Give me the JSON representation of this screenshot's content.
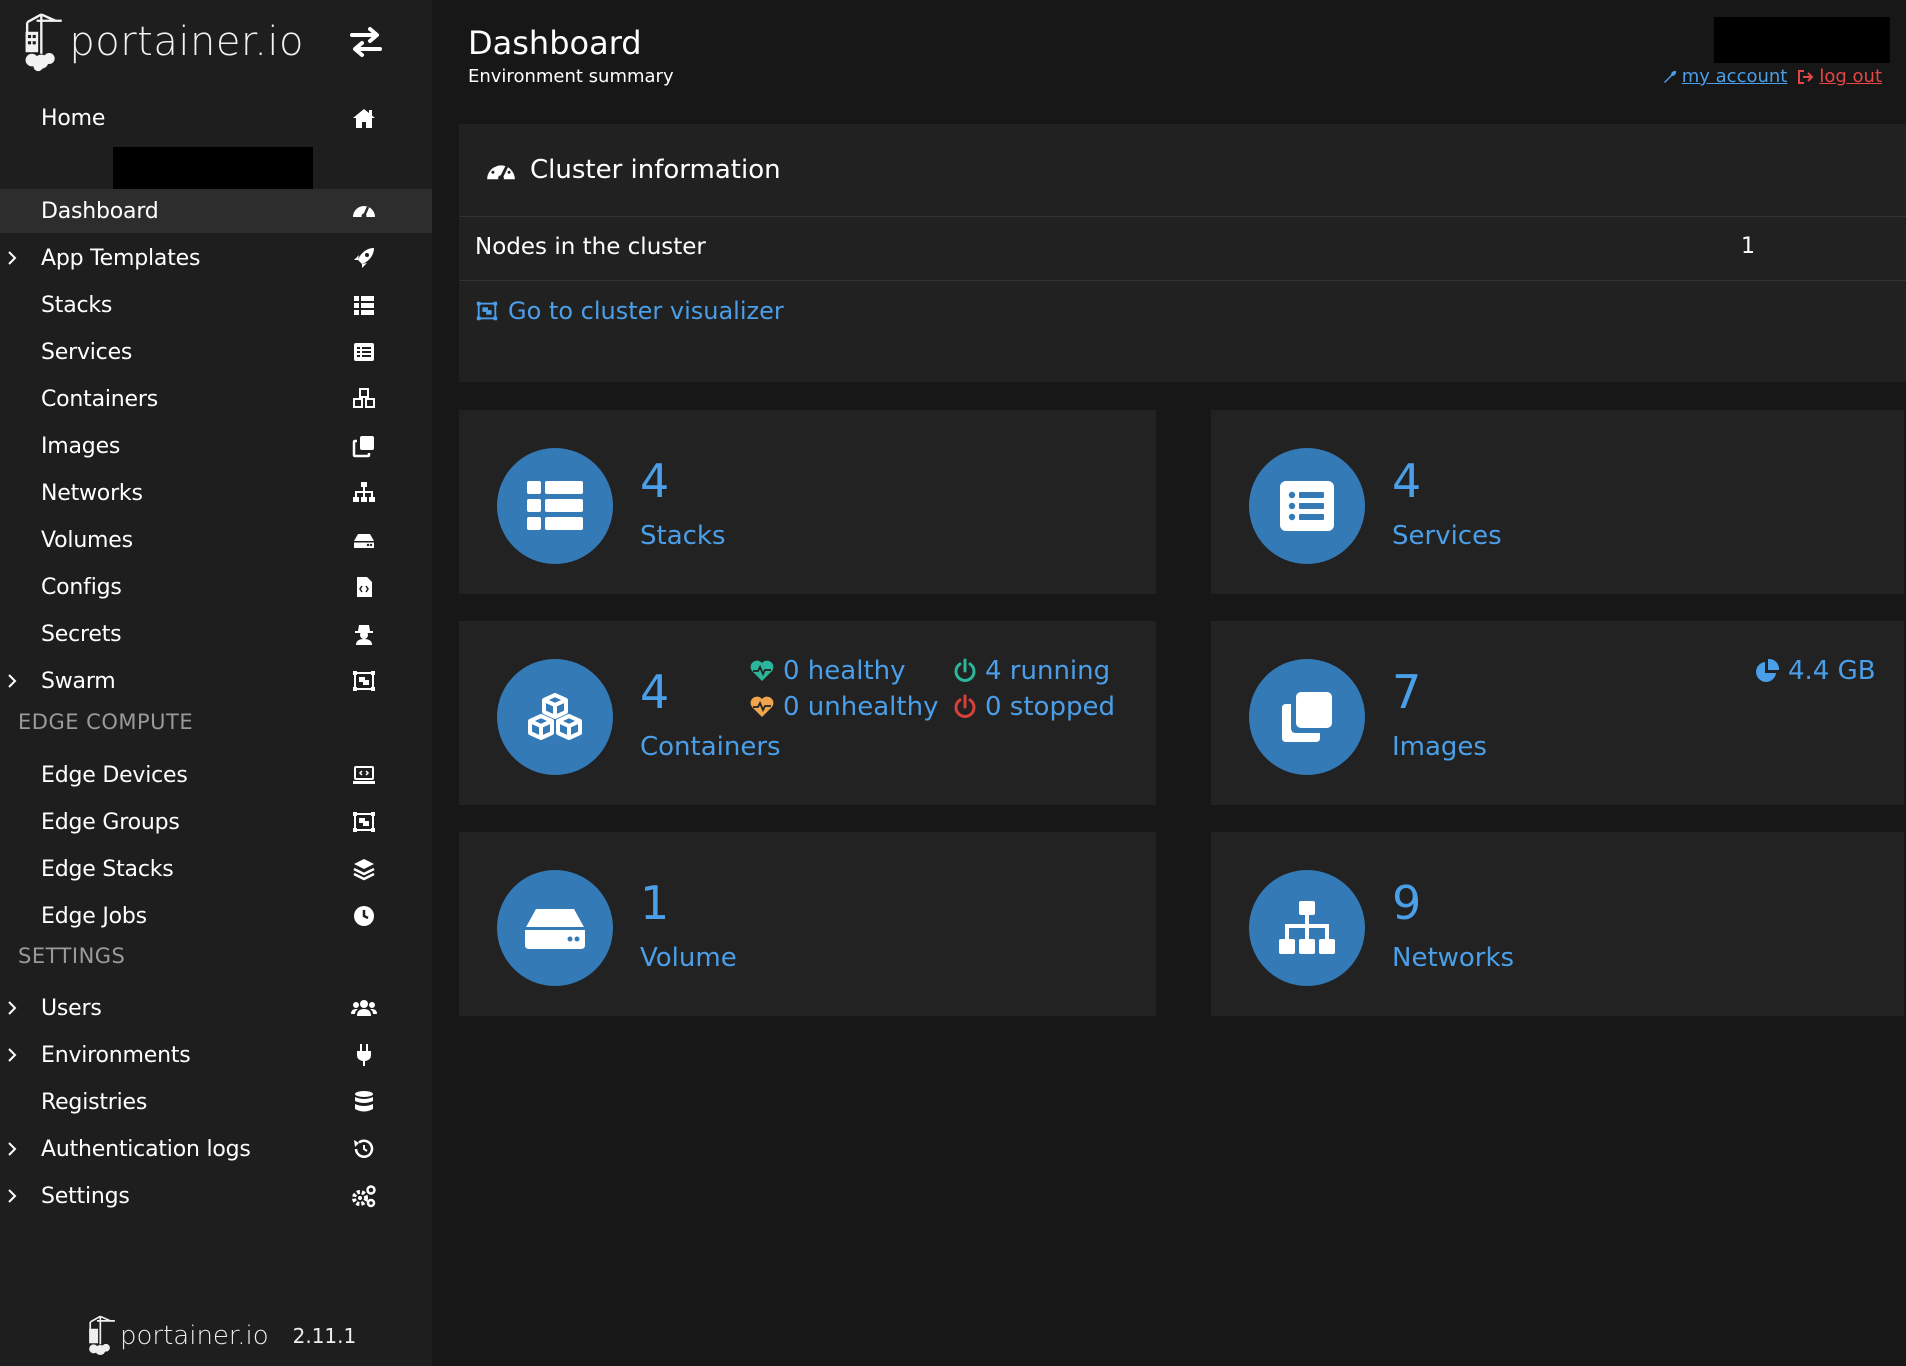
{
  "brand": {
    "name": "portainer.io",
    "version": "2.11.1"
  },
  "sidebar": {
    "home": "Home",
    "items": [
      {
        "label": "Dashboard",
        "icon": "tachometer-icon",
        "active": true
      },
      {
        "label": "App Templates",
        "icon": "rocket-icon",
        "expandable": true
      },
      {
        "label": "Stacks",
        "icon": "th-list-icon"
      },
      {
        "label": "Services",
        "icon": "list-alt-icon"
      },
      {
        "label": "Containers",
        "icon": "cubes-icon"
      },
      {
        "label": "Images",
        "icon": "clone-icon"
      },
      {
        "label": "Networks",
        "icon": "sitemap-icon"
      },
      {
        "label": "Volumes",
        "icon": "hdd-icon"
      },
      {
        "label": "Configs",
        "icon": "file-code-icon"
      },
      {
        "label": "Secrets",
        "icon": "user-secret-icon"
      },
      {
        "label": "Swarm",
        "icon": "object-group-icon",
        "expandable": true
      }
    ],
    "edge_title": "EDGE COMPUTE",
    "edge_items": [
      {
        "label": "Edge Devices",
        "icon": "laptop-code-icon"
      },
      {
        "label": "Edge Groups",
        "icon": "object-group-icon"
      },
      {
        "label": "Edge Stacks",
        "icon": "layer-group-icon"
      },
      {
        "label": "Edge Jobs",
        "icon": "clock-icon"
      }
    ],
    "settings_title": "SETTINGS",
    "settings_items": [
      {
        "label": "Users",
        "icon": "users-icon",
        "expandable": true
      },
      {
        "label": "Environments",
        "icon": "plug-icon",
        "expandable": true
      },
      {
        "label": "Registries",
        "icon": "database-icon"
      },
      {
        "label": "Authentication logs",
        "icon": "history-icon",
        "expandable": true
      },
      {
        "label": "Settings",
        "icon": "cogs-icon",
        "expandable": true
      }
    ]
  },
  "header": {
    "title": "Dashboard",
    "subtitle": "Environment summary",
    "my_account": "my account",
    "log_out": "log out"
  },
  "cluster": {
    "title": "Cluster information",
    "nodes_label": "Nodes in the cluster",
    "nodes_value": "1",
    "visualizer_link": "Go to cluster visualizer"
  },
  "tiles": {
    "stacks": {
      "count": "4",
      "label": "Stacks"
    },
    "services": {
      "count": "4",
      "label": "Services"
    },
    "containers": {
      "count": "4",
      "label": "Containers",
      "healthy": "0 healthy",
      "unhealthy": "0 unhealthy",
      "running": "4 running",
      "stopped": "0 stopped"
    },
    "images": {
      "count": "7",
      "label": "Images",
      "size": "4.4 GB"
    },
    "volumes": {
      "count": "1",
      "label": "Volume"
    },
    "networks": {
      "count": "9",
      "label": "Networks"
    }
  },
  "colors": {
    "accent": "#4a9fe8",
    "circle": "#337ab7",
    "healthy": "#2bb59a",
    "unhealthy": "#f0a54c",
    "running": "#2bb59a",
    "stopped": "#d9403a",
    "logout": "#e64646"
  }
}
